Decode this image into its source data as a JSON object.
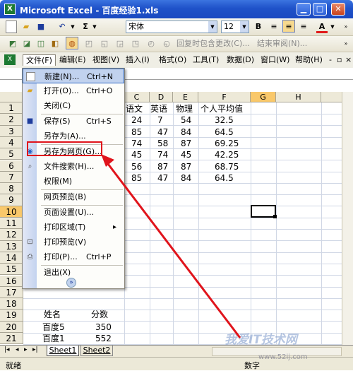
{
  "window": {
    "title": "Microsoft Excel - 百度经验1.xls",
    "app_icon": "X"
  },
  "toolbar": {
    "font_name": "宋体",
    "font_size": "12",
    "bold": "B",
    "sigma": "Σ",
    "font_color_letter": "A",
    "dropdown": "▼"
  },
  "review_toolbar": {
    "reply_label": "回复时包含更改(C)...",
    "end_review_label": "结束审阅(N)..."
  },
  "menubar": {
    "items": [
      "文件(F)",
      "编辑(E)",
      "视图(V)",
      "插入(I)",
      "格式(O)",
      "工具(T)",
      "数据(D)",
      "窗口(W)",
      "帮助(H)"
    ],
    "controls": [
      "-",
      "▫",
      "×"
    ]
  },
  "file_menu": {
    "items": [
      {
        "label": "新建(N)...",
        "shortcut": "Ctrl+N",
        "icon": "new-doc-icon"
      },
      {
        "label": "打开(O)...",
        "shortcut": "Ctrl+O",
        "icon": "open-folder-icon"
      },
      {
        "label": "关闭(C)",
        "shortcut": "",
        "icon": ""
      },
      {
        "label": "保存(S)",
        "shortcut": "Ctrl+S",
        "icon": "save-icon"
      },
      {
        "label": "另存为(A)...",
        "shortcut": "",
        "icon": ""
      },
      {
        "label": "另存为网页(G)...",
        "shortcut": "",
        "icon": "web-page-icon"
      },
      {
        "label": "文件搜索(H)...",
        "shortcut": "",
        "icon": "file-search-icon"
      },
      {
        "label": "权限(M)",
        "shortcut": "",
        "icon": ""
      },
      {
        "label": "网页预览(B)",
        "shortcut": "",
        "icon": ""
      },
      {
        "label": "页面设置(U)...",
        "shortcut": "",
        "icon": ""
      },
      {
        "label": "打印区域(T)",
        "shortcut": "",
        "icon": "",
        "submenu_arrow": "▸"
      },
      {
        "label": "打印预览(V)",
        "shortcut": "",
        "icon": "print-preview-icon"
      },
      {
        "label": "打印(P)...",
        "shortcut": "Ctrl+P",
        "icon": "print-icon"
      },
      {
        "label": "退出(X)",
        "shortcut": "",
        "icon": ""
      }
    ],
    "expand_glyph": "»"
  },
  "sheet": {
    "columns": [
      "C",
      "D",
      "E",
      "F",
      "G",
      "H"
    ],
    "rows": [
      "1",
      "2",
      "3",
      "4",
      "5",
      "6",
      "7",
      "8",
      "9",
      "10",
      "11",
      "12",
      "13",
      "14",
      "15",
      "16",
      "17",
      "18",
      "19",
      "20",
      "21"
    ],
    "header_row": [
      "语文",
      "英语",
      "物理",
      "个人平均值"
    ],
    "data": [
      [
        "24",
        "7",
        "54",
        "32.5"
      ],
      [
        "85",
        "47",
        "84",
        "64.5"
      ],
      [
        "74",
        "58",
        "87",
        "69.25"
      ],
      [
        "45",
        "74",
        "45",
        "42.25"
      ],
      [
        "56",
        "87",
        "87",
        "68.75"
      ],
      [
        "85",
        "47",
        "84",
        "64.5"
      ]
    ],
    "lower_table": {
      "header": [
        "姓名",
        "分数"
      ],
      "rows": [
        [
          "百度5",
          "350"
        ],
        [
          "百度1",
          "552"
        ]
      ]
    },
    "tabs": [
      "Sheet1",
      "Sheet2"
    ],
    "nav_arrows": [
      "|◂",
      "◂",
      "▸",
      "▸|"
    ]
  },
  "status": {
    "ready": "就绪",
    "num": "数字"
  },
  "watermark": {
    "text": "我爱IT技术网",
    "url": "www.52ij.com"
  },
  "colors": {
    "annotation": "#e0141c",
    "title_bar": "#1f52c9",
    "selected_header": "#f9c86a"
  }
}
